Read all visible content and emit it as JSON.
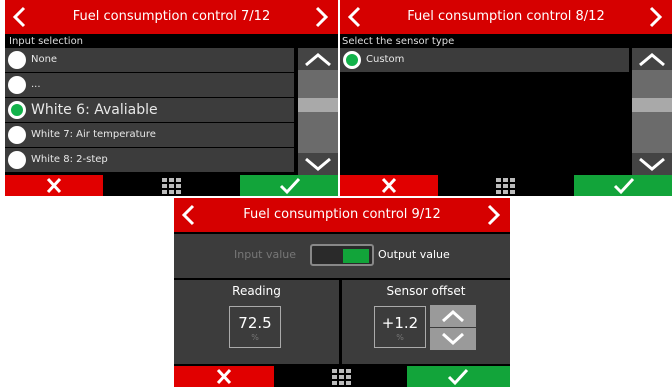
{
  "screens": [
    {
      "title": "Fuel consumption control 7/12",
      "caption": "Input selection",
      "items": [
        {
          "label": "None",
          "selected": false
        },
        {
          "label": "...",
          "selected": false
        },
        {
          "label": "White 6: Avaliable",
          "selected": true
        },
        {
          "label": "White 7: Air temperature",
          "selected": false
        },
        {
          "label": "White 8: 2-step",
          "selected": false
        }
      ]
    },
    {
      "title": "Fuel consumption control 8/12",
      "caption": "Select the sensor type",
      "items": [
        {
          "label": "Custom",
          "selected": true
        }
      ]
    },
    {
      "title": "Fuel consumption control 9/12",
      "toggle": {
        "left_label": "Input value",
        "right_label": "Output value",
        "state": "right"
      },
      "reading": {
        "title": "Reading",
        "value": "72.5",
        "unit": "%"
      },
      "offset": {
        "title": "Sensor offset",
        "value": "+1.2",
        "unit": "%"
      }
    }
  ],
  "icons": {
    "prev": "chevron-left-icon",
    "next": "chevron-right-icon",
    "scroll_up": "chevron-up-icon",
    "scroll_down": "chevron-down-icon",
    "cancel": "x-icon",
    "menu": "grid-icon",
    "confirm": "check-icon"
  },
  "colors": {
    "title_bar": "#d60000",
    "cancel": "#e10000",
    "confirm": "#12a43a",
    "selected_radio": "#12b24a",
    "list_item": "#3c3c3c",
    "background": "#000000"
  }
}
